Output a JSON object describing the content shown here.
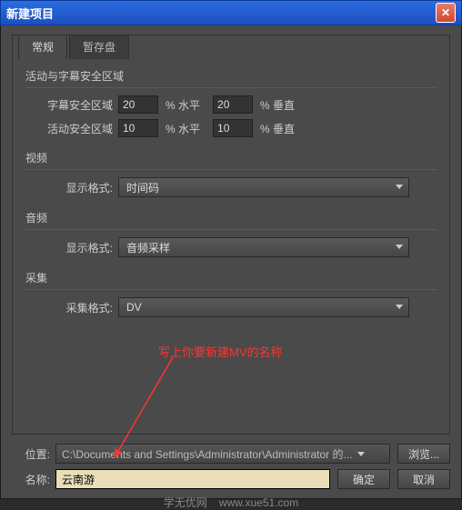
{
  "window": {
    "title": "新建项目"
  },
  "tabs": {
    "general": "常规",
    "scratch": "暂存盘"
  },
  "sections": {
    "safe": {
      "title": "活动与字幕安全区域",
      "subtitle_safe_label": "字幕安全区域",
      "action_safe_label": "活动安全区域",
      "sub_h": "20",
      "sub_v": "20",
      "act_h": "10",
      "act_v": "10",
      "pct_h": "% 水平",
      "pct_v": "% 垂直"
    },
    "video": {
      "title": "视频",
      "format_label": "显示格式:",
      "format_value": "时间码"
    },
    "audio": {
      "title": "音频",
      "format_label": "显示格式:",
      "format_value": "音频采样"
    },
    "capture": {
      "title": "采集",
      "format_label": "采集格式:",
      "format_value": "DV"
    }
  },
  "annotation": "写上你要新建MV的名称",
  "bottom": {
    "location_label": "位置:",
    "location_value": "C:\\Documents and Settings\\Administrator\\Administrator 的...",
    "browse": "浏览...",
    "name_label": "名称:",
    "name_value": "云南游",
    "ok": "确定",
    "cancel": "取消"
  },
  "footer": {
    "site": "学无优网",
    "url": "www.xue51.com"
  }
}
